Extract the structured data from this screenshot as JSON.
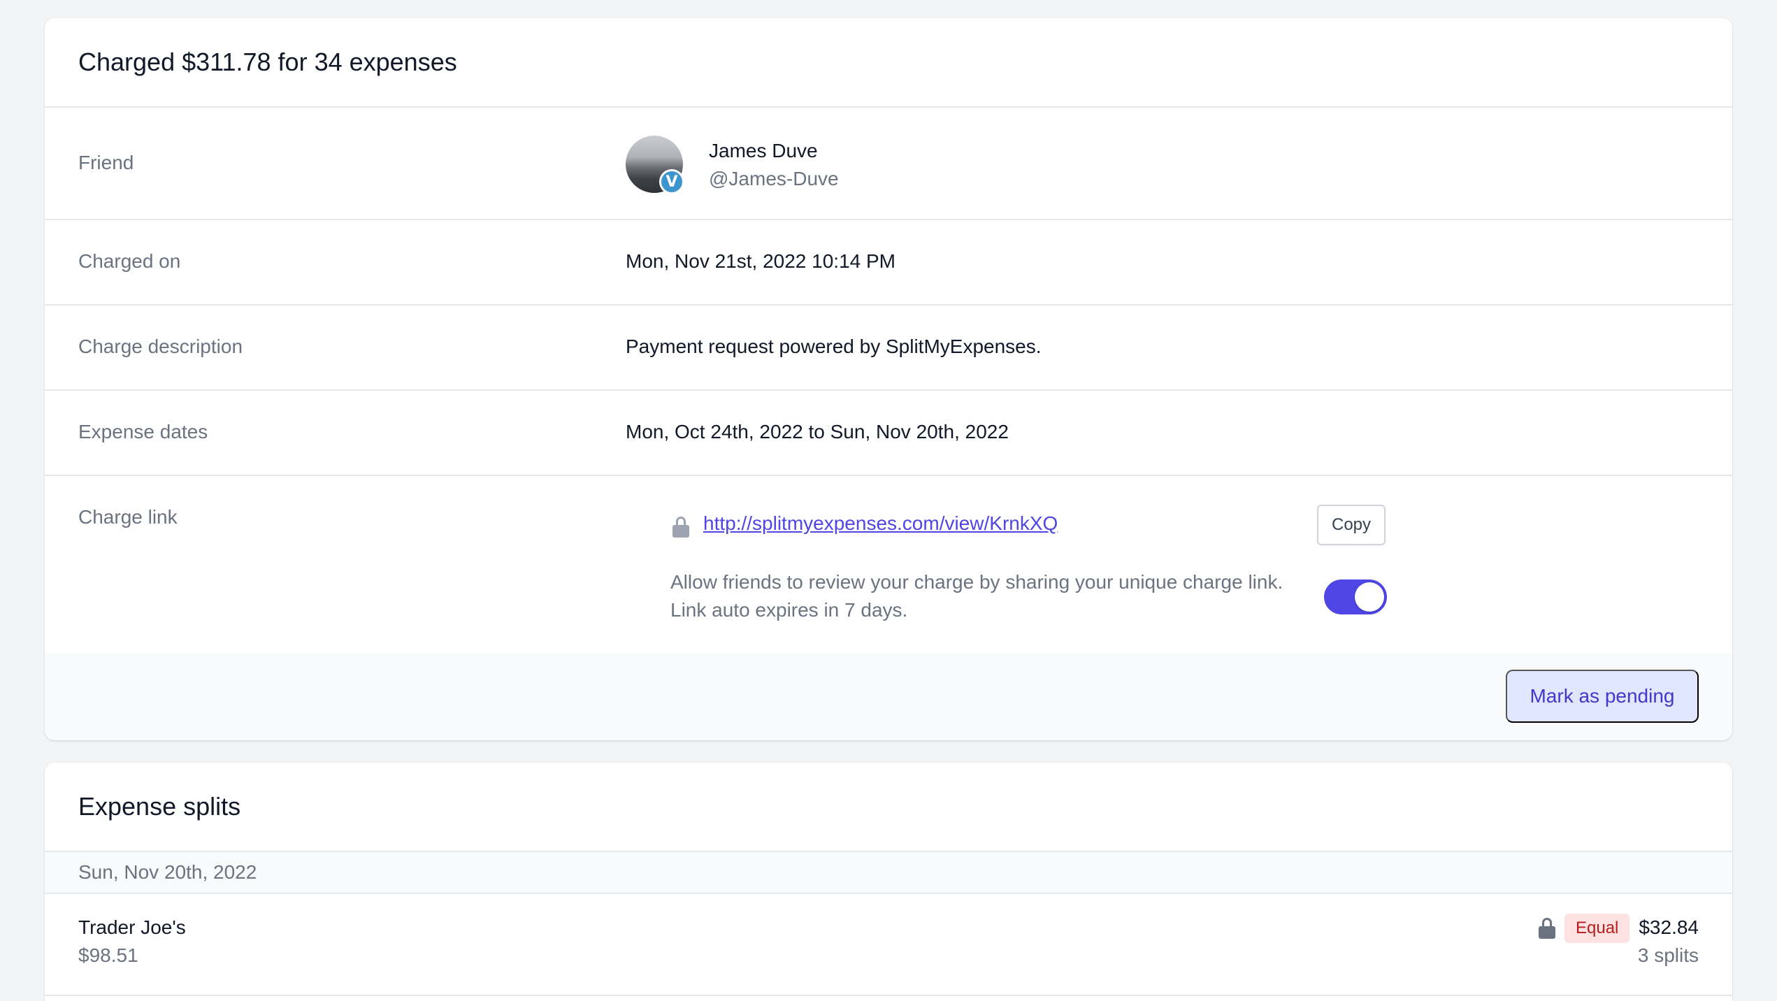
{
  "charge": {
    "title": "Charged $311.78 for 34 expenses",
    "friend": {
      "label": "Friend",
      "name": "James Duve",
      "handle": "@James-Duve",
      "badge": "V"
    },
    "charged_on": {
      "label": "Charged on",
      "value": "Mon, Nov 21st, 2022 10:14 PM"
    },
    "description": {
      "label": "Charge description",
      "value": "Payment request powered by SplitMyExpenses."
    },
    "expense_dates": {
      "label": "Expense dates",
      "value": "Mon, Oct 24th, 2022 to Sun, Nov 20th, 2022"
    },
    "charge_link": {
      "label": "Charge link",
      "url": "http://splitmyexpenses.com/view/KrnkXQ",
      "copy_label": "Copy",
      "help_line1": "Allow friends to review your charge by sharing your unique charge link.",
      "help_line2": "Link auto expires in 7 days.",
      "sharing_enabled": true
    },
    "footer": {
      "pending_label": "Mark as pending"
    }
  },
  "splits": {
    "title": "Expense splits",
    "groups": [
      {
        "date": "Sun, Nov 20th, 2022",
        "items": [
          {
            "name": "Trader Joe's",
            "total": "$98.51",
            "split_type": "Equal",
            "amount": "$32.84",
            "count": "3 splits"
          }
        ]
      }
    ]
  },
  "colors": {
    "accent": "#4f46e5",
    "page_bg": "#f3f4f6",
    "badge_bg": "#fee2e2",
    "badge_text": "#b91c1c",
    "venmo": "#3d95ce"
  },
  "icons": {
    "lock": "lock-icon",
    "venmo_badge": "venmo-badge-icon"
  }
}
